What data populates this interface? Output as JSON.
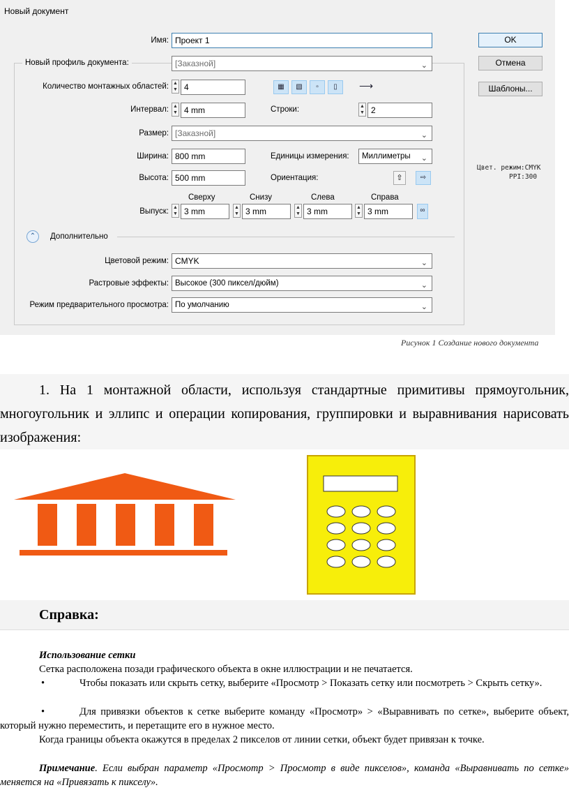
{
  "dialog": {
    "title": "Новый документ",
    "name_label": "Имя:",
    "name_value": "Проект 1",
    "profile_label": "Новый профиль документа:",
    "profile_value": "[Заказной]",
    "artboards_label": "Количество монтажных областей:",
    "artboards_value": "4",
    "spacing_label": "Интервал:",
    "spacing_value": "4 mm",
    "rows_label": "Строки:",
    "rows_value": "2",
    "size_label": "Размер:",
    "size_value": "[Заказной]",
    "width_label": "Ширина:",
    "width_value": "800 mm",
    "units_label": "Единицы измерения:",
    "units_value": "Миллиметры",
    "height_label": "Высота:",
    "height_value": "500 mm",
    "orientation_label": "Ориентация:",
    "bleed_label": "Выпуск:",
    "bleed_top_label": "Сверху",
    "bleed_bottom_label": "Снизу",
    "bleed_left_label": "Слева",
    "bleed_right_label": "Справа",
    "bleed_top": "3 mm",
    "bleed_bottom": "3 mm",
    "bleed_left": "3 mm",
    "bleed_right": "3 mm",
    "advanced_label": "Дополнительно",
    "color_mode_label": "Цветовой режим:",
    "color_mode_value": "CMYK",
    "raster_label": "Растровые эффекты:",
    "raster_value": "Высокое (300 пиксел/дюйм)",
    "preview_label": "Режим предварительного просмотра:",
    "preview_value": "По умолчанию",
    "ok_label": "OK",
    "cancel_label": "Отмена",
    "templates_label": "Шаблоны...",
    "info_color": "Цвет. режим:CMYK",
    "info_ppi": "PPI:300"
  },
  "caption1": "Рисунок 1  Создание нового документа",
  "task": {
    "text": "1. На 1 монтажной области, используя стандартные примитивы прямоугольник, многоугольник  и эллипс и операции копирования, группировки и выравнивания нарисовать изображения:"
  },
  "colors": {
    "temple": "#f05a14",
    "calculator_body": "#f7ee0a",
    "calculator_border": "#c8a400"
  },
  "reference": {
    "heading": "Справка:",
    "subheading": "Использование сетки",
    "intro": "Сетка расположена позади графического объекта в окне иллюстрации и не печатается.",
    "bullet1": "Чтобы показать или скрыть сетку, выберите «Просмотр > Показать сетку или посмотреть > Скрыть сетку».",
    "bullet2": "Для привязки объектов к сетке выберите команду «Просмотр» > «Выравнивать по сетке», выберите объект, который нужно переместить, и перетащите его в нужное место.",
    "para": "Когда границы объекта окажутся в пределах 2 пикселов от линии сетки, объект будет привязан к точке.",
    "note_bold": "Примечание",
    "note_rest": ". Если выбран параметр «Просмотр > Просмотр в виде пикселов», команда «Выравнивать по сетке» меняется на «Привязать к пикселу»."
  }
}
